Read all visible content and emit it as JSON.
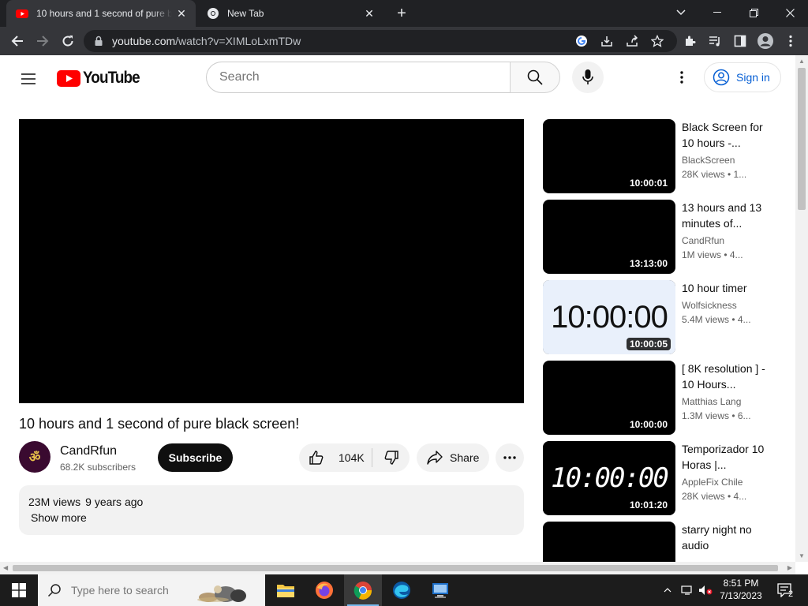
{
  "browser": {
    "tabs": [
      {
        "title": "10 hours and 1 second of pure black screen!",
        "active": true
      },
      {
        "title": "New Tab",
        "active": false
      }
    ],
    "url_host": "youtube.com",
    "url_path": "/watch?v=XIMLoLxmTDw"
  },
  "header": {
    "logo_text": "YouTube",
    "search_placeholder": "Search",
    "signin_label": "Sign in"
  },
  "video": {
    "title": "10 hours and 1 second of pure black screen!",
    "channel": "CandRfun",
    "subscribers": "68.2K subscribers",
    "subscribe_label": "Subscribe",
    "likes": "104K",
    "share_label": "Share",
    "views": "23M views",
    "age": "9 years ago",
    "show_more": "Show more"
  },
  "recommendations": [
    {
      "title": "Black Screen for 10 hours -...",
      "channel": "BlackScreen",
      "meta": "28K views  •  1...",
      "duration": "10:00:01",
      "thumb": "black"
    },
    {
      "title": "13 hours and 13 minutes of...",
      "channel": "CandRfun",
      "meta": "1M views  •  4...",
      "duration": "13:13:00",
      "thumb": "black"
    },
    {
      "title": "10 hour timer",
      "channel": "Wolfsickness",
      "meta": "5.4M views  •  4...",
      "duration": "10:00:05",
      "thumb": "clock",
      "thumb_text": "10:00:00"
    },
    {
      "title": "[ 8K resolution ] - 10 Hours...",
      "channel": "Matthias Lang",
      "meta": "1.3M views  •  6...",
      "duration": "10:00:00",
      "thumb": "black"
    },
    {
      "title": "Temporizador 10 Horas |...",
      "channel": "AppleFix Chile",
      "meta": "28K views  •  4...",
      "duration": "10:01:20",
      "thumb": "digital",
      "thumb_text": "10:00:00"
    },
    {
      "title": "starry night no audio",
      "channel": "",
      "meta": "",
      "duration": "",
      "thumb": "black"
    }
  ],
  "taskbar": {
    "search_placeholder": "Type here to search",
    "time": "8:51 PM",
    "date": "7/13/2023",
    "notification_count": "2"
  },
  "colors": {
    "youtube_red": "#ff0000",
    "link_blue": "#065fd4",
    "chrome_dark": "#202124",
    "taskbar": "#1c1c1c"
  }
}
